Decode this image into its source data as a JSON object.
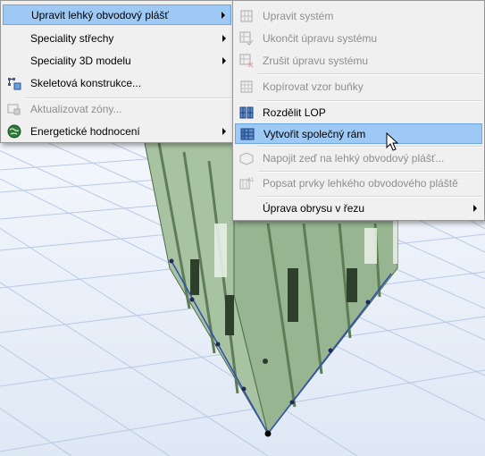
{
  "left_menu": {
    "items": [
      {
        "label": "Upravit lehký obvodový plášť",
        "submenu": true,
        "highlighted": true,
        "disabled": false,
        "icon": "none"
      },
      {
        "label": "Speciality střechy",
        "submenu": true,
        "highlighted": false,
        "disabled": false,
        "icon": "none"
      },
      {
        "label": "Speciality 3D modelu",
        "submenu": true,
        "highlighted": false,
        "disabled": false,
        "icon": "none"
      },
      {
        "label": "Skeletová konstrukce...",
        "submenu": false,
        "highlighted": false,
        "disabled": false,
        "icon": "skeletal-structure-icon"
      },
      {
        "label": "Aktualizovat zóny...",
        "submenu": false,
        "highlighted": false,
        "disabled": true,
        "icon": "update-zones-icon"
      },
      {
        "label": "Energetické hodnocení",
        "submenu": true,
        "highlighted": false,
        "disabled": false,
        "icon": "globe-icon"
      }
    ]
  },
  "right_menu": {
    "items": [
      {
        "label": "Upravit systém",
        "disabled": true,
        "icon": "edit-system-icon"
      },
      {
        "label": "Ukončit úpravu systému",
        "disabled": true,
        "icon": "finish-edit-icon"
      },
      {
        "label": "Zrušit úpravu systému",
        "disabled": true,
        "icon": "cancel-edit-icon"
      },
      {
        "label": "Kopírovat vzor buňky",
        "disabled": true,
        "icon": "copy-cell-pattern-icon"
      },
      {
        "label": "Rozdělit LOP",
        "disabled": false,
        "icon": "split-curtain-wall-icon"
      },
      {
        "label": "Vytvořit společný rám",
        "disabled": false,
        "highlighted": true,
        "icon": "create-common-frame-icon"
      },
      {
        "label": "Napojit zeď na lehký obvodový plášť...",
        "disabled": true,
        "icon": "connect-wall-icon"
      },
      {
        "label": "Popsat prvky lehkého obvodového pláště",
        "disabled": true,
        "icon": "label-elements-icon"
      },
      {
        "label": "Úprava obrysu v řezu",
        "disabled": false,
        "submenu": true,
        "icon": "none"
      }
    ]
  },
  "colors": {
    "highlight": "#9dc9f4",
    "menu_bg": "#f0f0f0",
    "disabled_text": "#8e8e8e",
    "building_green": "#8fb08a",
    "selection_blue": "#2d4fb5"
  }
}
